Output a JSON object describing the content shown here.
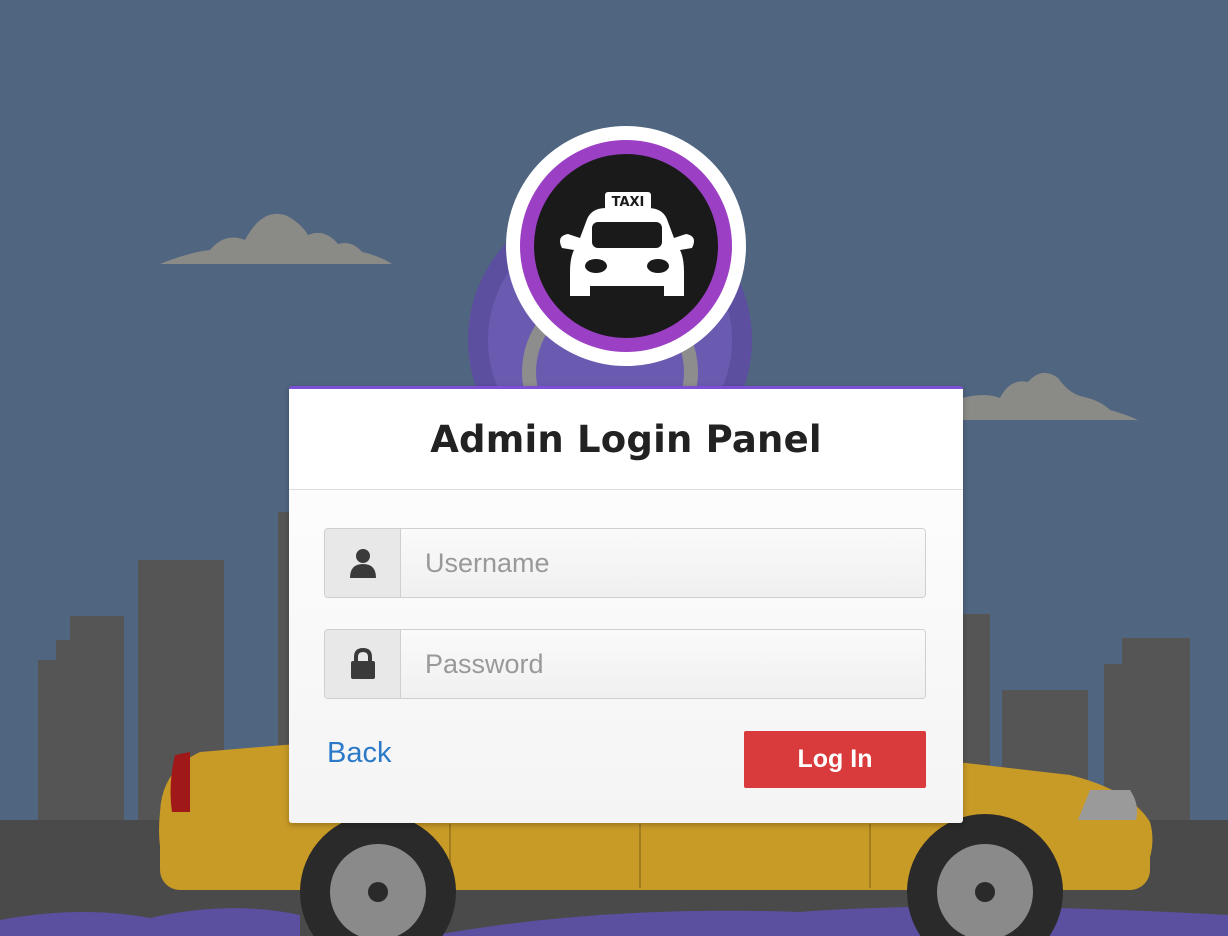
{
  "panel": {
    "title": "Admin Login Panel"
  },
  "logo": {
    "sign_text": "TAXI",
    "ring_color": "#9b3fc4"
  },
  "form": {
    "username": {
      "placeholder": "Username",
      "value": "",
      "icon": "user-icon"
    },
    "password": {
      "placeholder": "Password",
      "value": "",
      "icon": "lock-icon"
    },
    "back_label": "Back",
    "login_label": "Log In"
  },
  "colors": {
    "sky": "#506580",
    "accent": "#7b4fd6",
    "button": "#d93b3d",
    "link": "#2a7ac8"
  }
}
